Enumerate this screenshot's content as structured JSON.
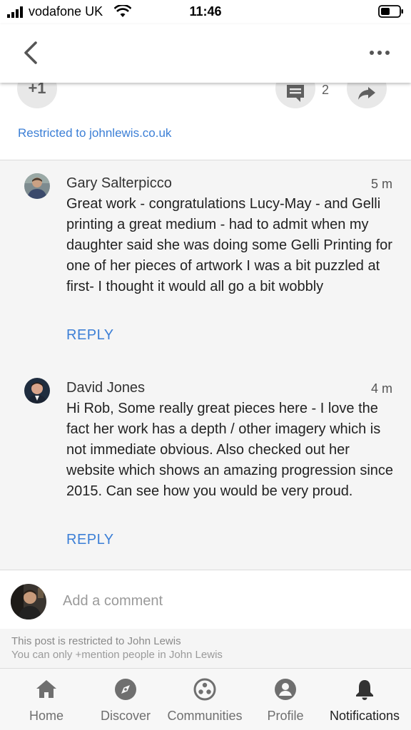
{
  "status_bar": {
    "carrier": "vodafone UK",
    "time": "11:46"
  },
  "post": {
    "plus_one_label": "+1",
    "comment_count": "2",
    "restricted_text": "Restricted to johnlewis.co.uk"
  },
  "comments": [
    {
      "author": "Gary Salterpicco",
      "time": "5 m",
      "text": "Great work - congratulations Lucy-May - and Gelli printing a great medium - had to admit when my daughter said she was doing some Gelli Printing for one of her pieces of artwork I was a bit puzzled at first- I thought it would all go a bit wobbly",
      "reply_label": "REPLY"
    },
    {
      "author": "David Jones",
      "time": "4 m",
      "text": "Hi Rob,  Some really great pieces here - I love the fact her work has a depth / other imagery which is not immediate obvious. Also checked out her website which shows an amazing progression since 2015.  Can see how you would be very proud.",
      "reply_label": "REPLY"
    }
  ],
  "add_comment": {
    "placeholder": "Add a comment"
  },
  "notice": {
    "line1": "This post is restricted to John Lewis",
    "line2": "You can only +mention people in John Lewis"
  },
  "bottom_nav": {
    "items": [
      {
        "label": "Home",
        "icon": "home-icon"
      },
      {
        "label": "Discover",
        "icon": "compass-icon"
      },
      {
        "label": "Communities",
        "icon": "communities-icon"
      },
      {
        "label": "Profile",
        "icon": "profile-icon"
      },
      {
        "label": "Notifications",
        "icon": "bell-icon"
      }
    ],
    "active": "Notifications"
  },
  "colors": {
    "link_blue": "#3c7fd6",
    "comment_bg": "#f5f5f5",
    "nav_icon": "#6f6f6f"
  }
}
